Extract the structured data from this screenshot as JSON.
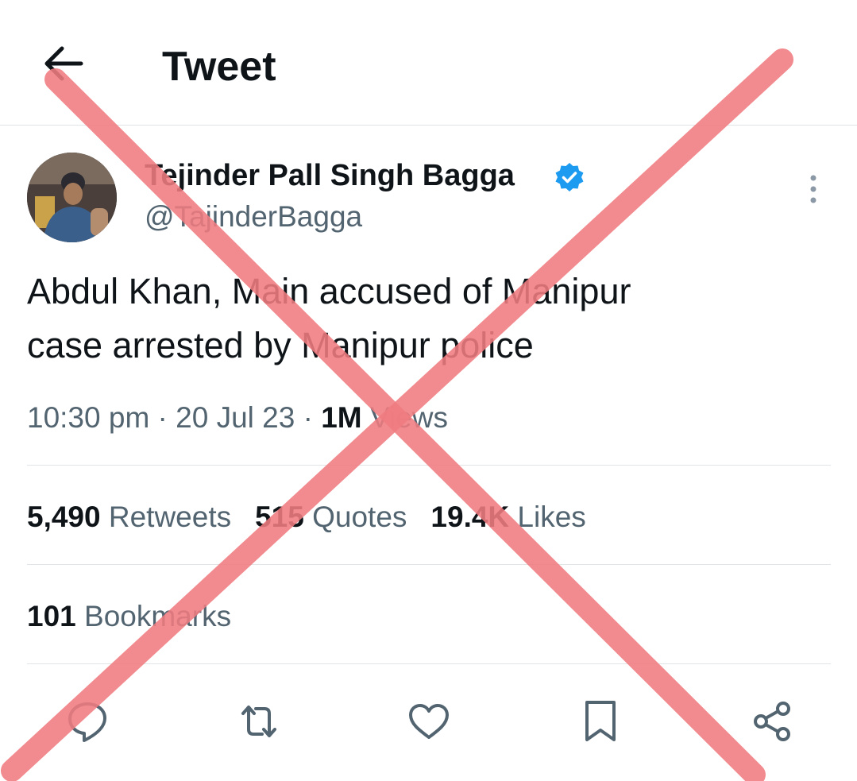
{
  "header": {
    "title": "Tweet",
    "back_icon": "arrow-left-icon"
  },
  "tweet": {
    "author": {
      "display_name": "Tejinder Pall Singh Bagga",
      "handle": "@TajinderBagga",
      "verified": true,
      "verified_color": "#1d9bf0"
    },
    "text_lines": [
      "Abdul Khan, Main accused of Manipur",
      "case arrested by Manipur police"
    ],
    "time": "10:30 pm",
    "separator": " · ",
    "date": "20 Jul 23",
    "views_count": "1M",
    "views_label": " Views",
    "stats": {
      "retweets": {
        "count": "5,490",
        "label": " Retweets"
      },
      "quotes": {
        "count": "515",
        "label": " Quotes"
      },
      "likes": {
        "count": "19.4K",
        "label": " Likes"
      }
    },
    "bookmarks": {
      "count": "101",
      "label": " Bookmarks"
    }
  },
  "actions": [
    "reply-icon",
    "retweet-icon",
    "like-icon",
    "bookmark-icon",
    "share-icon"
  ],
  "overlay": {
    "type": "red-x-mark",
    "color": "#f07c80"
  },
  "colors": {
    "text_primary": "#0f1419",
    "text_secondary": "#536471",
    "divider": "#e1e5e8"
  }
}
